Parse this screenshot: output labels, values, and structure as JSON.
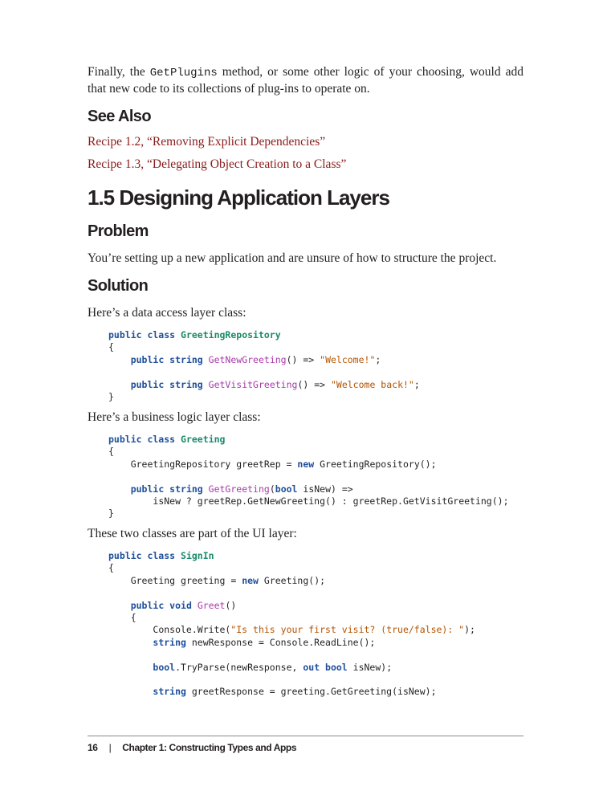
{
  "intro": {
    "before": "Finally, the ",
    "code": "GetPlugins",
    "after": " method, or some other logic of your choosing, would add that new code to its collections of plug-ins to operate on."
  },
  "see_also": {
    "heading": "See Also",
    "links": [
      "Recipe 1.2, “Removing Explicit Dependencies”",
      "Recipe 1.3, “Delegating Object Creation to a Class”"
    ]
  },
  "section": {
    "title": "1.5 Designing Application Layers"
  },
  "problem": {
    "heading": "Problem",
    "text": "You’re setting up a new application and are unsure of how to structure the project."
  },
  "solution": {
    "heading": "Solution",
    "data_layer_intro": "Here’s a data access layer class:",
    "business_layer_intro": "Here’s a business logic layer class:",
    "ui_layer_intro": "These two classes are part of the UI layer:"
  },
  "code": {
    "repo": {
      "kw1": "public class",
      "name": "GreetingRepository",
      "open": "{",
      "l1_kw": "public string",
      "l1_fn": "GetNewGreeting",
      "l1_mid": "() => ",
      "l1_str": "\"Welcome!\"",
      "l1_end": ";",
      "l2_kw": "public string",
      "l2_fn": "GetVisitGreeting",
      "l2_mid": "() => ",
      "l2_str": "\"Welcome back!\"",
      "l2_end": ";",
      "close": "}"
    },
    "greeting": {
      "kw1": "public class",
      "name": "Greeting",
      "open": "{",
      "l1_a": "GreetingRepository greetRep = ",
      "l1_kw": "new",
      "l1_b": " GreetingRepository();",
      "l2_kw": "public string",
      "l2_fn": "GetGreeting",
      "l2_paren": "(",
      "l2_kw2": "bool",
      "l2_rest": " isNew) =>",
      "l3": "isNew ? greetRep.GetNewGreeting() : greetRep.GetVisitGreeting();",
      "close": "}"
    },
    "signin": {
      "kw1": "public class",
      "name": "SignIn",
      "open": "{",
      "l1_a": "Greeting greeting = ",
      "l1_kw": "new",
      "l1_b": " Greeting();",
      "l2_kw": "public void",
      "l2_fn": "Greet",
      "l2_rest": "()",
      "open2": "{",
      "l3_a": "Console.Write(",
      "l3_str": "\"Is this your first visit? (true/false): \"",
      "l3_b": ");",
      "l4_kw": "string",
      "l4_rest": " newResponse = Console.ReadLine();",
      "l5_kw": "bool",
      "l5_a": ".TryParse(newResponse, ",
      "l5_kw2": "out bool",
      "l5_b": " isNew);",
      "l6_kw": "string",
      "l6_rest": " greetResponse = greeting.GetGreeting(isNew);"
    }
  },
  "footer": {
    "page_number": "16",
    "separator": "|",
    "chapter": "Chapter 1: Constructing Types and Apps"
  }
}
